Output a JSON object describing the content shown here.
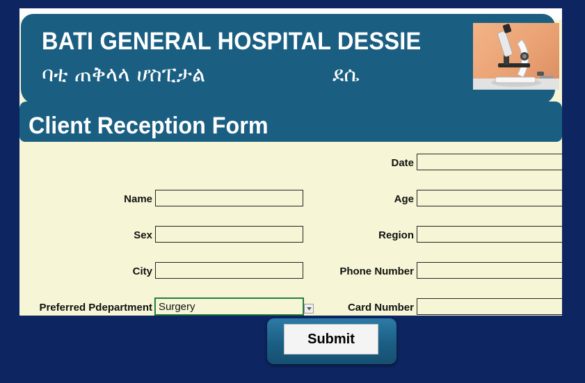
{
  "header": {
    "title": "BATI GENERAL HOSPITAL DESSIE",
    "amharic_name": "ባቲ ጠቅላላ ሆስፒታል",
    "amharic_city": "ደሴ",
    "photo": "microscope-image"
  },
  "form": {
    "title": "Client Reception Form",
    "labels": {
      "date": "Date",
      "name": "Name",
      "age": "Age",
      "sex": "Sex",
      "region": "Region",
      "city": "City",
      "phone": "Phone Number",
      "department": "Preferred Pdepartment",
      "card": "Card Number"
    },
    "values": {
      "department": "Surgery"
    }
  },
  "actions": {
    "submit_label": "Submit"
  },
  "colors": {
    "background": "#0d2560",
    "header": "#1a5f82",
    "sheet": "#f6f6d6"
  }
}
